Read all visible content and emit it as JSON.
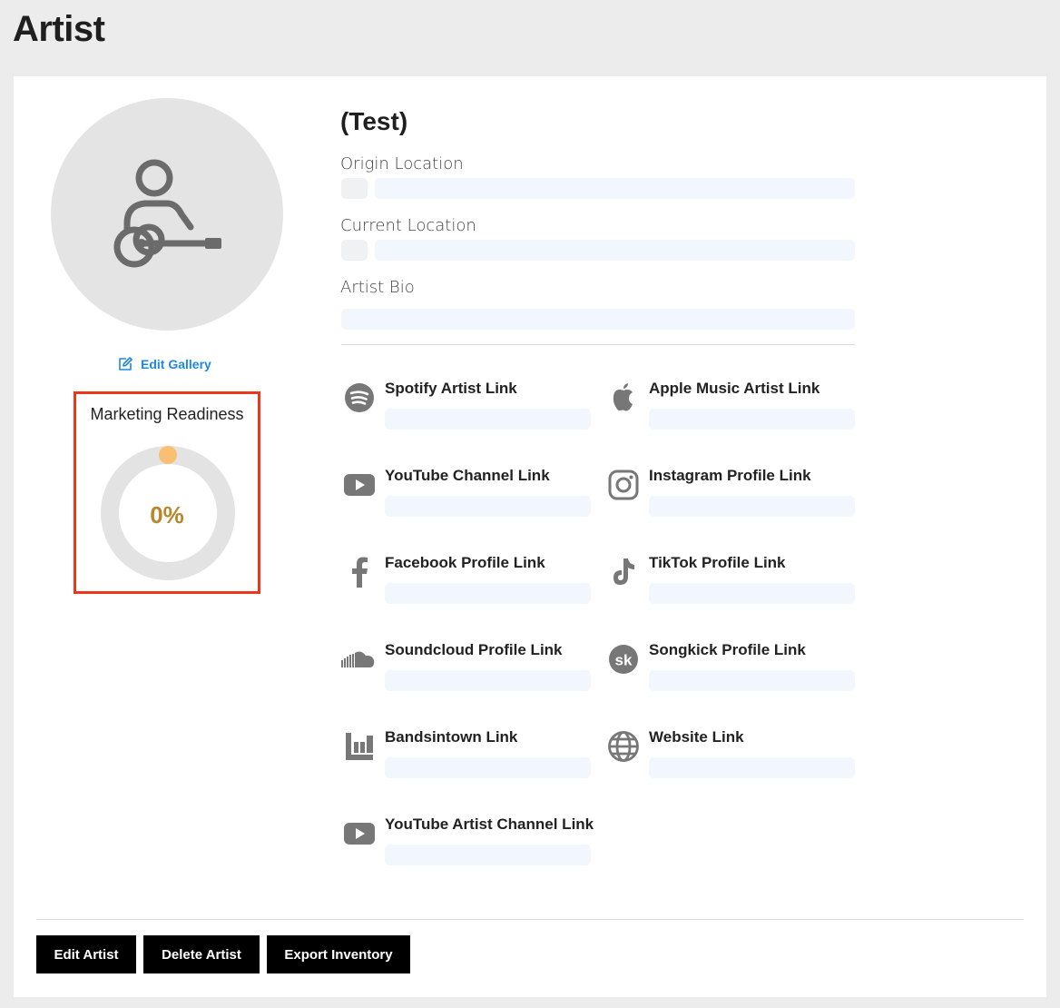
{
  "page": {
    "title": "Artist"
  },
  "artist": {
    "name": "(Test)",
    "origin_label": "Origin Location",
    "current_label": "Current Location",
    "bio_label": "Artist Bio"
  },
  "gallery": {
    "edit_label": "Edit Gallery"
  },
  "readiness": {
    "title": "Marketing Readiness",
    "percent_label": "0%",
    "value": 0,
    "track_color": "#e3e3e3",
    "knob_color": "#fbbf74",
    "text_color": "#b8882a"
  },
  "links": [
    {
      "label": "Spotify Artist Link",
      "icon": "spotify-icon"
    },
    {
      "label": "Apple Music Artist Link",
      "icon": "apple-icon"
    },
    {
      "label": "YouTube Channel Link",
      "icon": "youtube-icon"
    },
    {
      "label": "Instagram Profile Link",
      "icon": "instagram-icon"
    },
    {
      "label": "Facebook Profile Link",
      "icon": "facebook-icon"
    },
    {
      "label": "TikTok Profile Link",
      "icon": "tiktok-icon"
    },
    {
      "label": "Soundcloud Profile Link",
      "icon": "soundcloud-icon"
    },
    {
      "label": "Songkick Profile Link",
      "icon": "songkick-icon"
    },
    {
      "label": "Bandsintown Link",
      "icon": "bandsintown-icon"
    },
    {
      "label": "Website Link",
      "icon": "globe-icon"
    },
    {
      "label": "YouTube Artist Channel Link",
      "icon": "youtube-icon"
    }
  ],
  "actions": {
    "edit": "Edit Artist",
    "delete": "Delete Artist",
    "export": "Export Inventory"
  },
  "colors": {
    "accent": "#1e88e5",
    "highlight_border": "#e8391d",
    "placeholder": "#f2f7fd",
    "icon_gray": "#777777"
  }
}
